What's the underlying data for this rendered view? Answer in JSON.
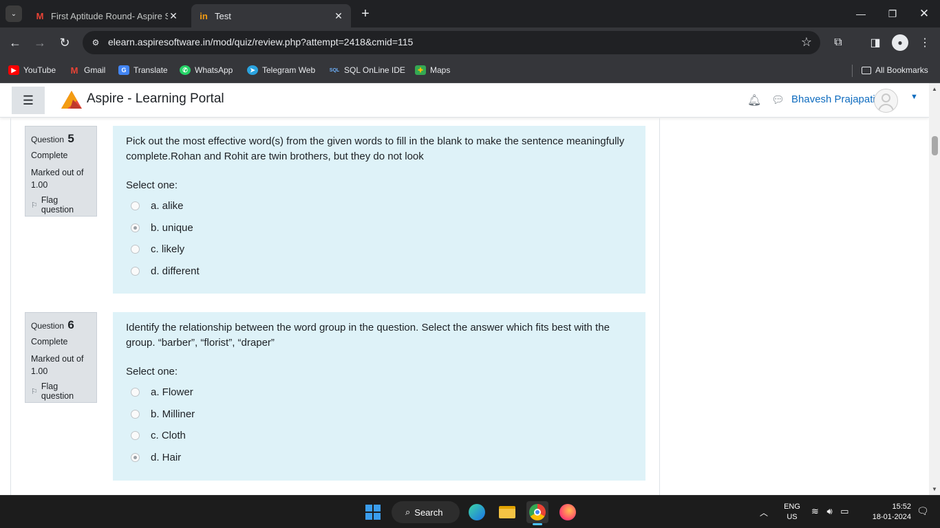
{
  "browser": {
    "tabs": [
      {
        "title": "First Aptitude Round- Aspire So",
        "favicon": "gmail-icon",
        "close": "✕"
      },
      {
        "title": "Test",
        "favicon": "aspire-in-icon",
        "close": "✕"
      }
    ],
    "url": "elearn.aspiresoftware.in/mod/quiz/review.php?attempt=2418&cmid=115",
    "bookmarks": [
      {
        "label": "YouTube",
        "icon": "youtube-icon",
        "color": "#ff0000"
      },
      {
        "label": "Gmail",
        "icon": "gmail-icon",
        "color": "#ea4335"
      },
      {
        "label": "Translate",
        "icon": "translate-icon",
        "color": "#4285f4"
      },
      {
        "label": "WhatsApp",
        "icon": "whatsapp-icon",
        "color": "#25d366"
      },
      {
        "label": "Telegram Web",
        "icon": "telegram-icon",
        "color": "#2aa3df"
      },
      {
        "label": "SQL OnLine IDE",
        "icon": "sql-icon",
        "color": "#1e6fb8"
      },
      {
        "label": "Maps",
        "icon": "maps-icon",
        "color": "#34a853"
      }
    ],
    "all_bookmarks": "All Bookmarks"
  },
  "site": {
    "brand": "Aspire - Learning Portal",
    "user": "Bhavesh Prajapati",
    "accent": "#0f6cbf"
  },
  "questions": [
    {
      "label": "Question",
      "number": "5",
      "state": "Complete",
      "grade": "Marked out of 1.00",
      "flag": "Flag question",
      "text": "Pick out the most effective word(s) from the given words to fill in the blank to make the sentence meaningfully complete.Rohan and Rohit are twin brothers, but they do not look",
      "prompt": "Select one:",
      "options": [
        {
          "label": "a. alike",
          "checked": false
        },
        {
          "label": "b. unique",
          "checked": true
        },
        {
          "label": "c. likely",
          "checked": false
        },
        {
          "label": "d. different",
          "checked": false
        }
      ]
    },
    {
      "label": "Question",
      "number": "6",
      "state": "Complete",
      "grade": "Marked out of 1.00",
      "flag": "Flag question",
      "text": "Identify the relationship between the word group in the question. Select the answer which fits best with the group. “barber”, “florist”, “draper”",
      "prompt": "Select one:",
      "options": [
        {
          "label": "a. Flower",
          "checked": false
        },
        {
          "label": "b. Milliner",
          "checked": false
        },
        {
          "label": "c. Cloth",
          "checked": false
        },
        {
          "label": "d. Hair",
          "checked": true
        }
      ]
    }
  ],
  "taskbar": {
    "search": "Search",
    "lang": [
      "ENG",
      "US"
    ],
    "time": "15:52",
    "date": "18-01-2024"
  }
}
